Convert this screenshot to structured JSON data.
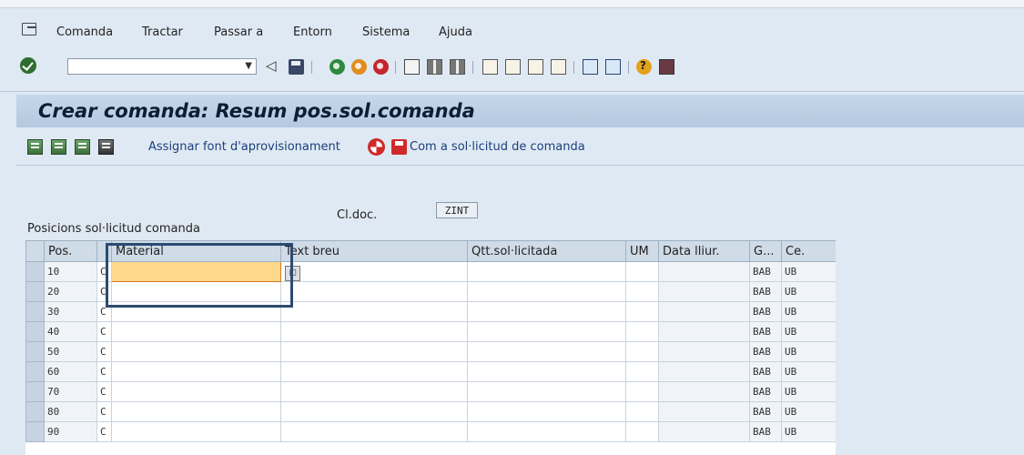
{
  "menu": {
    "items": [
      {
        "label": "Comanda"
      },
      {
        "label": "Tractar"
      },
      {
        "label": "Passar a"
      },
      {
        "label": "Entorn"
      },
      {
        "label": "Sistema"
      },
      {
        "label": "Ajuda"
      }
    ]
  },
  "toolbar": {
    "command_value": "",
    "icons": [
      "ok-icon",
      "back-icon",
      "save-icon",
      "back-green-icon",
      "exit-icon",
      "cancel-icon",
      "print-icon",
      "find-icon",
      "find-next-icon",
      "first-page-icon",
      "prev-page-icon",
      "next-page-icon",
      "last-page-icon",
      "new-session-icon",
      "shortcut-icon",
      "help-icon",
      "customize-icon"
    ]
  },
  "title": "Crear comanda: Resum pos.sol.comanda",
  "app_toolbar": {
    "assign_label": "Assignar font d'aprovisionament",
    "convert_label": "Com a sol·licitud de comanda"
  },
  "doc": {
    "label": "Cl.doc.",
    "value": "ZINT"
  },
  "section_title": "Posicions sol·licitud comanda",
  "table": {
    "headers": {
      "pos": "Pos.",
      "material": "Material",
      "text": "Text breu",
      "qty": "Qtt.sol·licitada",
      "um": "UM",
      "date": "Data lliur.",
      "group": "G...",
      "center": "Ce."
    },
    "rows": [
      {
        "pos": "10",
        "c": "C",
        "group": "BAB",
        "center": "UB"
      },
      {
        "pos": "20",
        "c": "C",
        "group": "BAB",
        "center": "UB"
      },
      {
        "pos": "30",
        "c": "C",
        "group": "BAB",
        "center": "UB"
      },
      {
        "pos": "40",
        "c": "C",
        "group": "BAB",
        "center": "UB"
      },
      {
        "pos": "50",
        "c": "C",
        "group": "BAB",
        "center": "UB"
      },
      {
        "pos": "60",
        "c": "C",
        "group": "BAB",
        "center": "UB"
      },
      {
        "pos": "70",
        "c": "C",
        "group": "BAB",
        "center": "UB"
      },
      {
        "pos": "80",
        "c": "C",
        "group": "BAB",
        "center": "UB"
      },
      {
        "pos": "90",
        "c": "C",
        "group": "BAB",
        "center": "UB"
      }
    ]
  }
}
